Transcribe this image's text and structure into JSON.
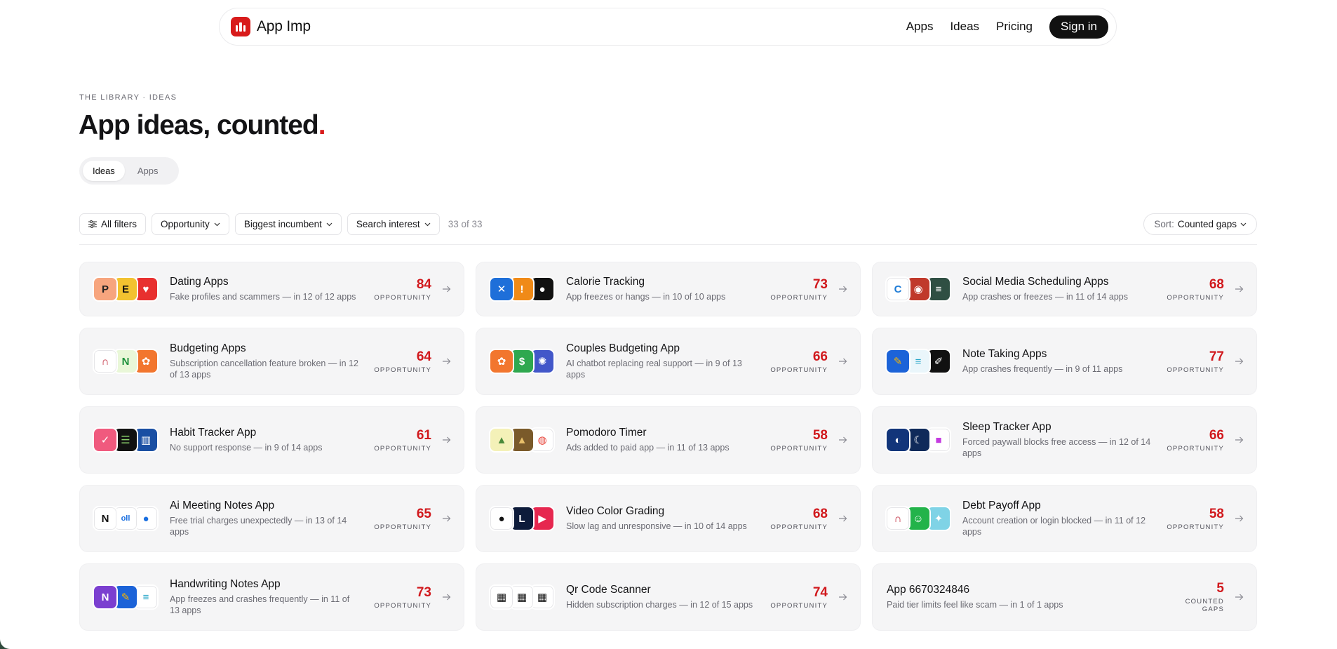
{
  "brand": {
    "name": "App Imp",
    "accent": "#d81b1b"
  },
  "nav": {
    "links": [
      "Apps",
      "Ideas",
      "Pricing"
    ],
    "signin": "Sign in"
  },
  "header": {
    "eyebrow": "THE LIBRARY · IDEAS",
    "title": "App ideas, counted",
    "title_dot": "."
  },
  "tabs": {
    "ideas": "Ideas",
    "apps": "Apps",
    "active": "Ideas"
  },
  "filters": {
    "all": "All filters",
    "opportunity": "Opportunity",
    "incumbent": "Biggest incumbent",
    "interest": "Search interest",
    "count": "33 of 33"
  },
  "sort": {
    "label": "Sort:",
    "value": "Counted gaps"
  },
  "cards": [
    {
      "name": "Dating Apps",
      "desc": "Fake profiles and scammers — in 12 of 12 apps",
      "score": "84",
      "label": "OPPORTUNITY",
      "icons": [
        {
          "bg": "#f7a57e",
          "fg": "#222",
          "t": "P",
          "name": "app-icon-p"
        },
        {
          "bg": "#f2c230",
          "fg": "#111",
          "t": "E",
          "name": "app-icon-e"
        },
        {
          "bg": "#e8302f",
          "fg": "#fff",
          "t": "♥",
          "name": "app-icon-flame"
        }
      ]
    },
    {
      "name": "Calorie Tracking",
      "desc": "App freezes or hangs — in 10 of 10 apps",
      "score": "73",
      "label": "OPPORTUNITY",
      "icons": [
        {
          "bg": "#1e6fd9",
          "fg": "#fff",
          "t": "✕",
          "name": "app-icon-runner"
        },
        {
          "bg": "#f08a17",
          "fg": "#fff",
          "t": "!",
          "name": "app-icon-orange"
        },
        {
          "bg": "#111",
          "fg": "#fff",
          "t": "●",
          "name": "app-icon-apple"
        }
      ]
    },
    {
      "name": "Social Media Scheduling Apps",
      "desc": "App crashes or freezes — in 11 of 14 apps",
      "score": "68",
      "label": "OPPORTUNITY",
      "icons": [
        {
          "bg": "#ffffff",
          "fg": "#1d7bd6",
          "t": "C",
          "name": "app-icon-c"
        },
        {
          "bg": "#c0392b",
          "fg": "#fff",
          "t": "◉",
          "name": "app-icon-red"
        },
        {
          "bg": "#2f4f43",
          "fg": "#fff",
          "t": "≡",
          "name": "app-icon-stack"
        }
      ]
    },
    {
      "name": "Budgeting Apps",
      "desc": "Subscription cancellation feature broken — in 12 of 13 apps",
      "score": "64",
      "label": "OPPORTUNITY",
      "icons": [
        {
          "bg": "#ffffff",
          "fg": "#c0283a",
          "t": "∩",
          "name": "app-icon-arc"
        },
        {
          "bg": "#e9f7d8",
          "fg": "#1b8f3a",
          "t": "N",
          "name": "app-icon-n"
        },
        {
          "bg": "#f2762e",
          "fg": "#fff",
          "t": "✿",
          "name": "app-icon-butterfly"
        }
      ]
    },
    {
      "name": "Couples Budgeting App",
      "desc": "AI chatbot replacing real support — in 9 of 13 apps",
      "score": "66",
      "label": "OPPORTUNITY",
      "icons": [
        {
          "bg": "#f2762e",
          "fg": "#fff",
          "t": "✿",
          "name": "app-icon-butterfly"
        },
        {
          "bg": "#2fa84f",
          "fg": "#fff",
          "t": "$",
          "name": "app-icon-money"
        },
        {
          "bg": "#4257c9",
          "fg": "#fff",
          "t": "✺",
          "name": "app-icon-tree"
        }
      ]
    },
    {
      "name": "Note Taking Apps",
      "desc": "App crashes frequently — in 9 of 11 apps",
      "score": "77",
      "label": "OPPORTUNITY",
      "icons": [
        {
          "bg": "#1c63d8",
          "fg": "#f5b400",
          "t": "✎",
          "name": "app-icon-pencil"
        },
        {
          "bg": "#eaf6fb",
          "fg": "#2aa7c9",
          "t": "≡",
          "name": "app-icon-lines"
        },
        {
          "bg": "#111",
          "fg": "#fff",
          "t": "✐",
          "name": "app-icon-pen"
        }
      ]
    },
    {
      "name": "Habit Tracker App",
      "desc": "No support response — in 9 of 14 apps",
      "score": "61",
      "label": "OPPORTUNITY",
      "icons": [
        {
          "bg": "#f05a7e",
          "fg": "#fff",
          "t": "✓",
          "name": "app-icon-check"
        },
        {
          "bg": "#111",
          "fg": "#8bd36b",
          "t": "☰",
          "name": "app-icon-list"
        },
        {
          "bg": "#1a4fa3",
          "fg": "#fff",
          "t": "▥",
          "name": "app-icon-bars"
        }
      ]
    },
    {
      "name": "Pomodoro Timer",
      "desc": "Ads added to paid app — in 11 of 13 apps",
      "score": "58",
      "label": "OPPORTUNITY",
      "icons": [
        {
          "bg": "#f4f1b8",
          "fg": "#4a8a3a",
          "t": "▲",
          "name": "app-icon-landscape"
        },
        {
          "bg": "#7a5a2a",
          "fg": "#e8c06a",
          "t": "▲",
          "name": "app-icon-hill"
        },
        {
          "bg": "#ffffff",
          "fg": "#e8463c",
          "t": "◍",
          "name": "app-icon-tomato"
        }
      ]
    },
    {
      "name": "Sleep Tracker App",
      "desc": "Forced paywall blocks free access — in 12 of 14 apps",
      "score": "66",
      "label": "OPPORTUNITY",
      "icons": [
        {
          "bg": "#12357a",
          "fg": "#fff",
          "t": "◐",
          "name": "app-icon-night"
        },
        {
          "bg": "#0f2a5a",
          "fg": "#fff",
          "t": "☾",
          "name": "app-icon-moon"
        },
        {
          "bg": "#ffffff",
          "fg": "#c43be0",
          "t": "■",
          "name": "app-icon-gradient"
        }
      ]
    },
    {
      "name": "Ai Meeting Notes App",
      "desc": "Free trial charges unexpectedly — in 13 of 14 apps",
      "score": "65",
      "label": "OPPORTUNITY",
      "icons": [
        {
          "bg": "#ffffff",
          "fg": "#111",
          "t": "N",
          "name": "app-icon-notion"
        },
        {
          "bg": "#ffffff",
          "fg": "#1a6fe0",
          "t": "oll",
          "name": "app-icon-otter"
        },
        {
          "bg": "#ffffff",
          "fg": "#1a6fe0",
          "t": "●",
          "name": "app-icon-blue-dot"
        }
      ]
    },
    {
      "name": "Video Color Grading",
      "desc": "Slow lag and unresponsive — in 10 of 14 apps",
      "score": "68",
      "label": "OPPORTUNITY",
      "icons": [
        {
          "bg": "#ffffff",
          "fg": "#111",
          "t": "●",
          "name": "app-icon-black-dot"
        },
        {
          "bg": "#0d1b3a",
          "fg": "#fff",
          "t": "L",
          "name": "app-icon-l"
        },
        {
          "bg": "#e6274f",
          "fg": "#fff",
          "t": "▶",
          "name": "app-icon-clapper"
        }
      ]
    },
    {
      "name": "Debt Payoff App",
      "desc": "Account creation or login blocked — in 11 of 12 apps",
      "score": "58",
      "label": "OPPORTUNITY",
      "icons": [
        {
          "bg": "#ffffff",
          "fg": "#c0283a",
          "t": "∩",
          "name": "app-icon-arc"
        },
        {
          "bg": "#23b34a",
          "fg": "#fff",
          "t": "☺",
          "name": "app-icon-face"
        },
        {
          "bg": "#7fd3e6",
          "fg": "#fff",
          "t": "✦",
          "name": "app-icon-bird"
        }
      ]
    },
    {
      "name": "Handwriting Notes App",
      "desc": "App freezes and crashes frequently — in 11 of 13 apps",
      "score": "73",
      "label": "OPPORTUNITY",
      "icons": [
        {
          "bg": "#7b3fd0",
          "fg": "#fff",
          "t": "N",
          "name": "app-icon-onenote"
        },
        {
          "bg": "#1c63d8",
          "fg": "#f5b400",
          "t": "✎",
          "name": "app-icon-pencil"
        },
        {
          "bg": "#ffffff",
          "fg": "#2aa7c9",
          "t": "≡",
          "name": "app-icon-lines"
        }
      ]
    },
    {
      "name": "Qr Code Scanner",
      "desc": "Hidden subscription charges — in 12 of 15 apps",
      "score": "74",
      "label": "OPPORTUNITY",
      "icons": [
        {
          "bg": "#ffffff",
          "fg": "#111",
          "t": "▦",
          "name": "app-icon-qr"
        },
        {
          "bg": "#ffffff",
          "fg": "#111",
          "t": "▦",
          "name": "app-icon-qr"
        },
        {
          "bg": "#ffffff",
          "fg": "#111",
          "t": "▦",
          "name": "app-icon-qr"
        }
      ]
    },
    {
      "name": "App 6670324846",
      "desc": "Paid tier limits feel like scam — in 1 of 1 apps",
      "score": "5",
      "label": "COUNTED GAPS",
      "icons": []
    }
  ],
  "row_heights": [
    78,
    96,
    96,
    96,
    96
  ]
}
